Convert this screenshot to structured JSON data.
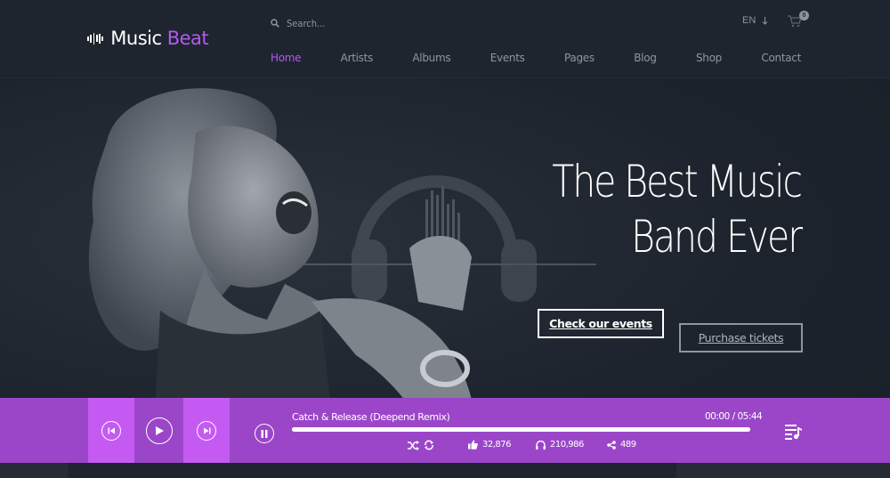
{
  "header": {
    "logo": {
      "word1": "Music",
      "word2": "Beat"
    },
    "search": {
      "placeholder": "Search..."
    },
    "language": {
      "value": "EN"
    },
    "cart": {
      "count": "0"
    },
    "nav": [
      {
        "label": "Home",
        "active": true
      },
      {
        "label": "Artists"
      },
      {
        "label": "Albums"
      },
      {
        "label": "Events"
      },
      {
        "label": "Pages"
      },
      {
        "label": "Blog"
      },
      {
        "label": "Shop"
      },
      {
        "label": "Contact"
      }
    ]
  },
  "hero": {
    "headline": "The Best Music Band Ever",
    "buttons": {
      "events": "Check our events",
      "tickets": "Purchase tickets"
    }
  },
  "player": {
    "track": "Catch & Release (Deepend Remix)",
    "time": "00:00 / 05:44",
    "progress": 1.0,
    "likes": "32,876",
    "listens": "210,986",
    "shares": "489"
  },
  "colors": {
    "accent": "#b359f0",
    "player_bg": "#9b46c9",
    "player_ctrl": "#c45af2",
    "header_bg": "#1e252e"
  }
}
